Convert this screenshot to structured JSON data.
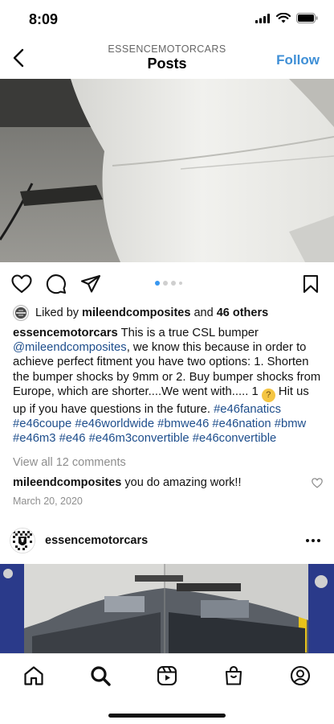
{
  "status_bar": {
    "time": "8:09"
  },
  "header": {
    "subtitle": "ESSENCEMOTORCARS",
    "title": "Posts",
    "follow_label": "Follow"
  },
  "post": {
    "carousel": {
      "count": 4,
      "active_index": 0
    },
    "likes": {
      "prefix": "Liked by ",
      "user": "mileendcomposites",
      "middle": " and ",
      "others": "46 others"
    },
    "caption": {
      "user": "essencemotorcars",
      "text1": " This is a true CSL bumper ",
      "mention": "@mileendcomposites",
      "text2": ", we know this because in order to achieve perfect fitment you have two options: 1. Shorten the bumper shocks by 9mm or 2. Buy bumper shocks from Europe, which are shorter....We went with..... 1 ",
      "emoji_icon": "thinking-face-emoji",
      "text3": " Hit us up if you have questions in the future. ",
      "hashtags": "#e46fanatics #e46coupe #e46worldwide #bmwe46 #e46nation #bmw #e46m3 #e46 #e46m3convertible #e46convertible"
    },
    "view_comments": "View all 12 comments",
    "comment": {
      "user": "mileendcomposites",
      "text": " you do amazing work!!"
    },
    "date": "March 20, 2020"
  },
  "next_post": {
    "user": "essencemotorcars"
  },
  "bottom_nav": [
    "home-icon",
    "search-icon",
    "reels-icon",
    "shop-icon",
    "profile-icon"
  ],
  "colors": {
    "accent": "#3f8fd6",
    "link": "#1e4e8c",
    "muted": "#8e8e8e",
    "dot_active": "#3897f0"
  }
}
